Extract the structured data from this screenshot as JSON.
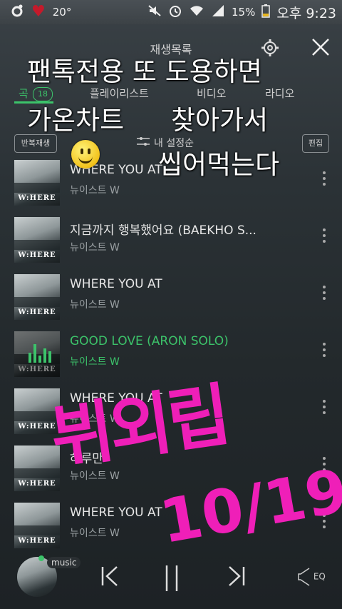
{
  "status_bar": {
    "temperature": "20°",
    "battery": "15%",
    "time": "오후 9:23"
  },
  "header": {
    "title": "재생목록"
  },
  "tabs": [
    {
      "label": "곡",
      "count": "18",
      "active": true
    },
    {
      "label": "플레이리스트"
    },
    {
      "label": "비디오"
    },
    {
      "label": "라디오"
    }
  ],
  "toolbar": {
    "repeat_label": "반복재생",
    "sort_label": "내 설정순",
    "edit_label": "편집"
  },
  "songs": [
    {
      "title": "WHERE YOU AT",
      "artist": "뉴이스트 W"
    },
    {
      "title": "지금까지 행복했어요 (BAEKHO S...",
      "artist": "뉴이스트 W"
    },
    {
      "title": "WHERE YOU AT",
      "artist": "뉴이스트 W"
    },
    {
      "title": "GOOD LOVE (ARON SOLO)",
      "artist": "뉴이스트 W",
      "playing": true
    },
    {
      "title": "WHERE YOU AT",
      "artist": "뉴이스트 W"
    },
    {
      "title": "하루만",
      "artist": "뉴이스트 W"
    },
    {
      "title": "WHERE YOU AT",
      "artist": "뉴이스트 W"
    }
  ],
  "album_art_text": "W:HERE",
  "overlay_text": {
    "line1": "팬톡전용 또 도용하면",
    "line2a": "가온차트",
    "line2b": "찾아가서",
    "line3": "씹어먹는다",
    "signature": "뷔외립",
    "date": "10/19"
  },
  "player": {
    "music_label": "music",
    "eq_label": "EQ"
  },
  "colors": {
    "accent": "#3cc36a",
    "handwriting": "#ef1fb8"
  }
}
